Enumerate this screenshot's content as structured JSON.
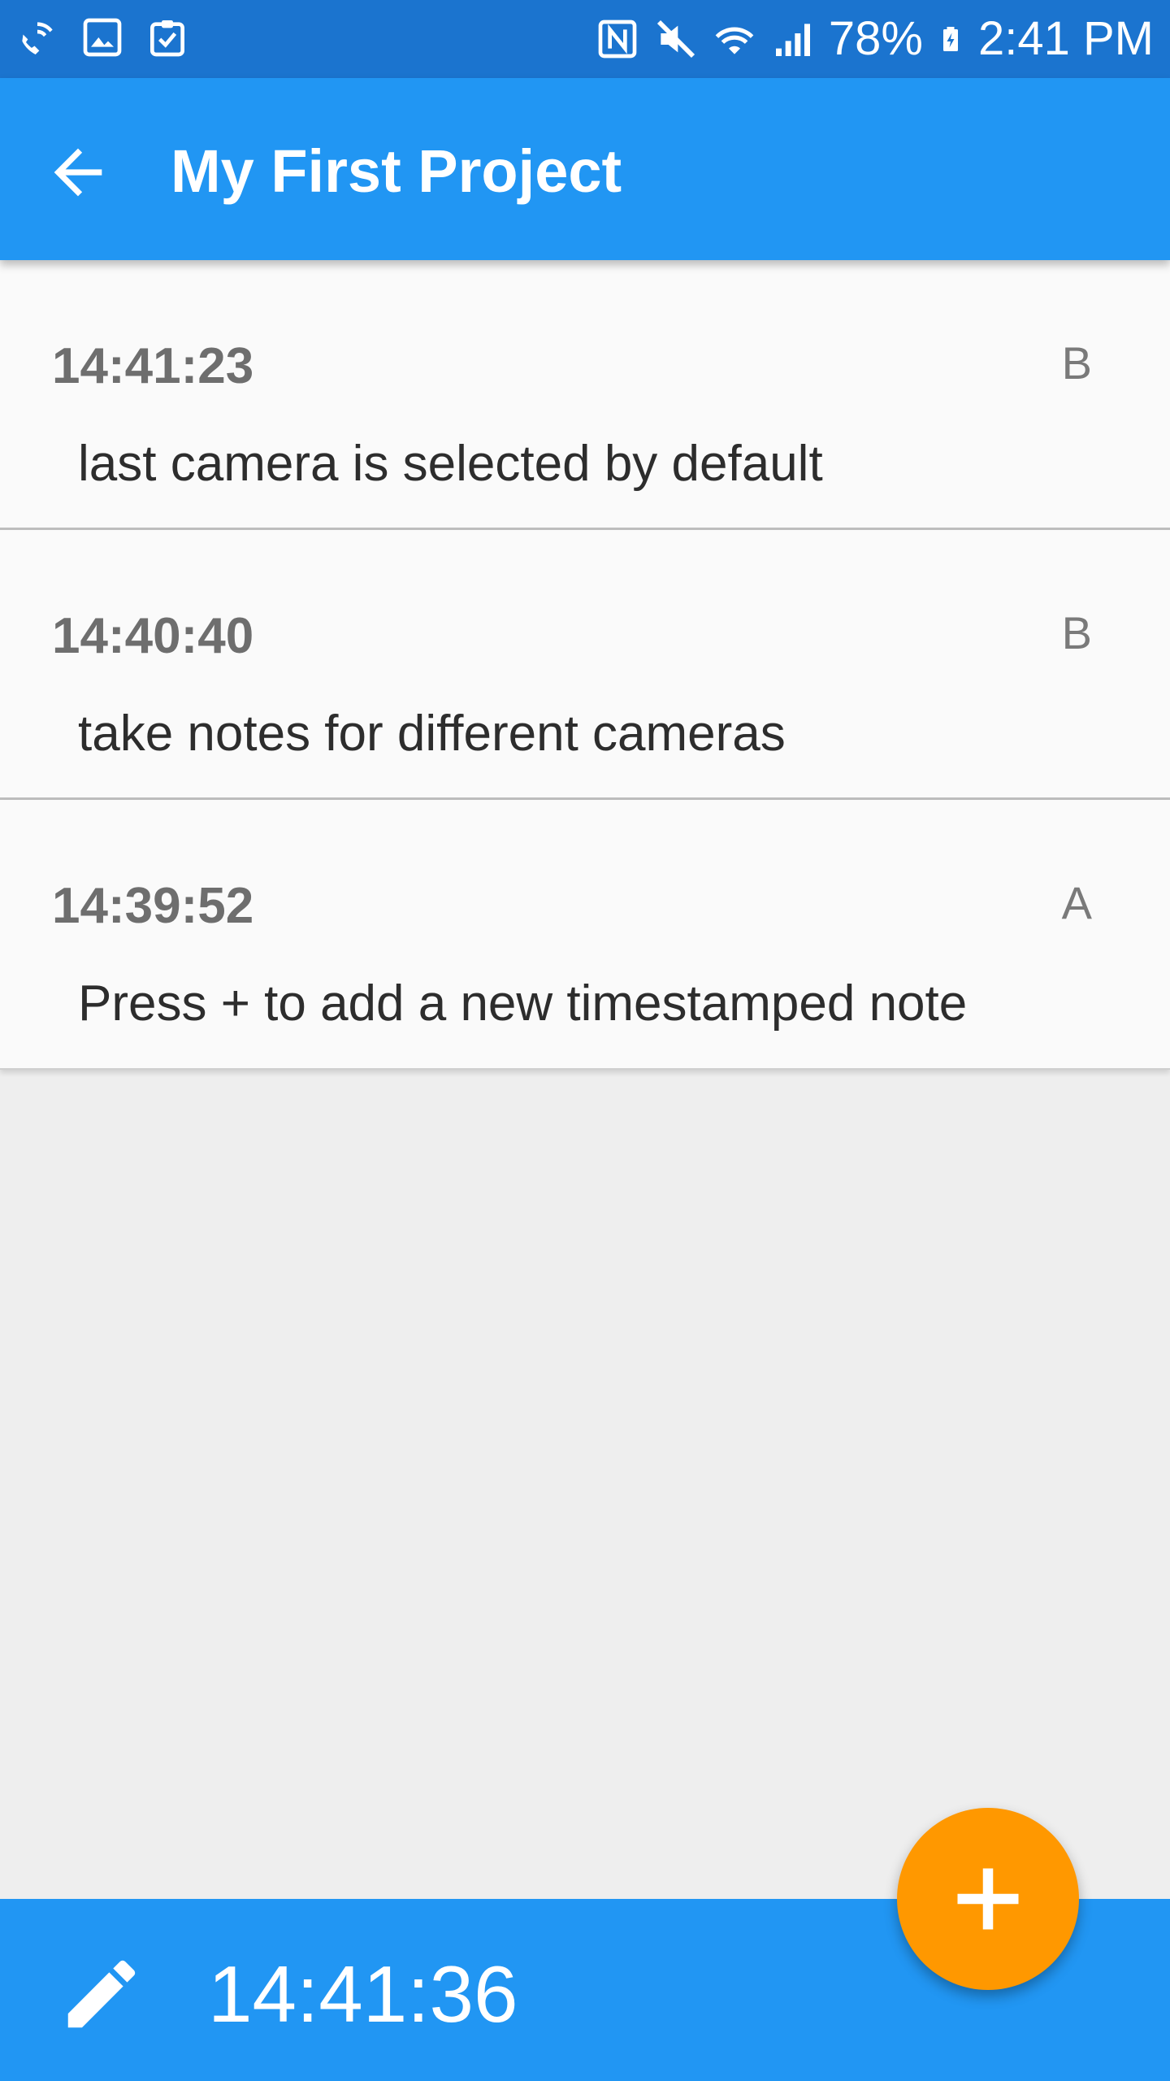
{
  "status_bar": {
    "battery_percent": "78%",
    "time": "2:41 PM",
    "icons_left": [
      "wifi-calling-icon",
      "image-icon",
      "clipboard-check-icon"
    ],
    "icons_right": [
      "nfc-icon",
      "mute-icon",
      "wifi-icon",
      "signal-icon",
      "battery-charging-icon"
    ]
  },
  "app_bar": {
    "title": "My First Project",
    "back_icon": "arrow-back-icon"
  },
  "notes": [
    {
      "time": "14:41:23",
      "camera": "B",
      "text": "last camera is selected by default"
    },
    {
      "time": "14:40:40",
      "camera": "B",
      "text": "take notes for different cameras"
    },
    {
      "time": "14:39:52",
      "camera": "A",
      "text": "Press + to add a new timestamped note"
    }
  ],
  "bottom_bar": {
    "current_time": "14:41:36",
    "edit_icon": "pencil-icon"
  },
  "fab": {
    "icon": "plus-icon"
  },
  "colors": {
    "primary": "#2196f3",
    "status_bar": "#1b74cf",
    "accent": "#ff9800"
  }
}
